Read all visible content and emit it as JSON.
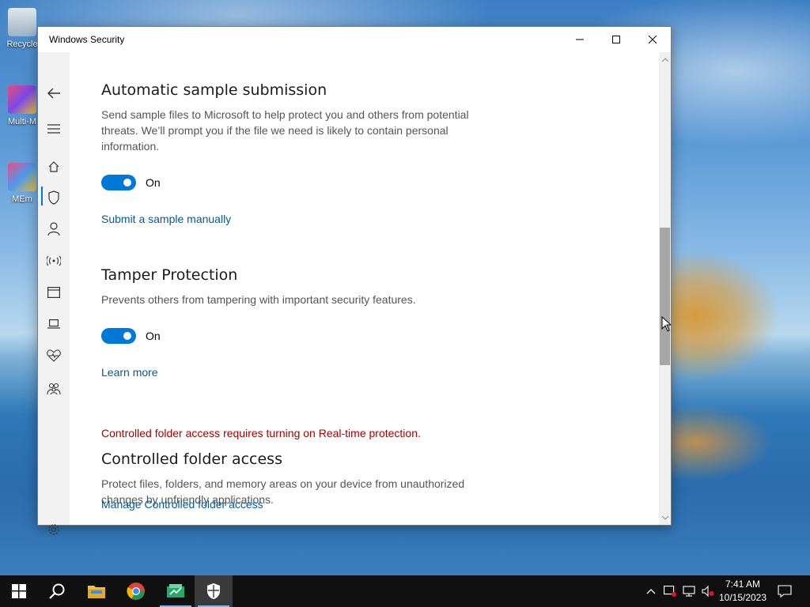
{
  "desktop": {
    "icons": [
      {
        "label": "Recycle"
      },
      {
        "label": "Multi-M"
      },
      {
        "label": "MEm"
      }
    ]
  },
  "window": {
    "title": "Windows Security",
    "controls": {
      "minimize": "—",
      "maximize": "☐",
      "close": "✕"
    }
  },
  "sidebar": {
    "items": [
      "back",
      "menu",
      "home",
      "virus-protection",
      "account",
      "firewall",
      "app-browser",
      "device-security",
      "device-performance",
      "family",
      "settings"
    ]
  },
  "sections": {
    "sample": {
      "title": "Automatic sample submission",
      "description": "Send sample files to Microsoft to help protect you and others from potential threats. We’ll prompt you if the file we need is likely to contain personal information.",
      "toggle_label": "On",
      "toggle_on": true,
      "link": "Submit a sample manually"
    },
    "tamper": {
      "title": "Tamper Protection",
      "description": "Prevents others from tampering with important security features.",
      "toggle_label": "On",
      "toggle_on": true,
      "link": "Learn more"
    },
    "controlled": {
      "warning": "Controlled folder access requires turning on Real-time protection.",
      "title": "Controlled folder access",
      "description": "Protect files, folders, and memory areas on your device from unauthorized changes by unfriendly applications.",
      "link": "Manage Controlled folder access"
    }
  },
  "taskbar": {
    "apps": [
      "start",
      "search",
      "file-explorer",
      "chrome",
      "app",
      "windows-security"
    ],
    "clock": {
      "time": "7:41 AM",
      "date": "10/15/2023"
    }
  },
  "colors": {
    "accent": "#0078d7",
    "link": "#005a9e",
    "warning": "#a80000"
  }
}
